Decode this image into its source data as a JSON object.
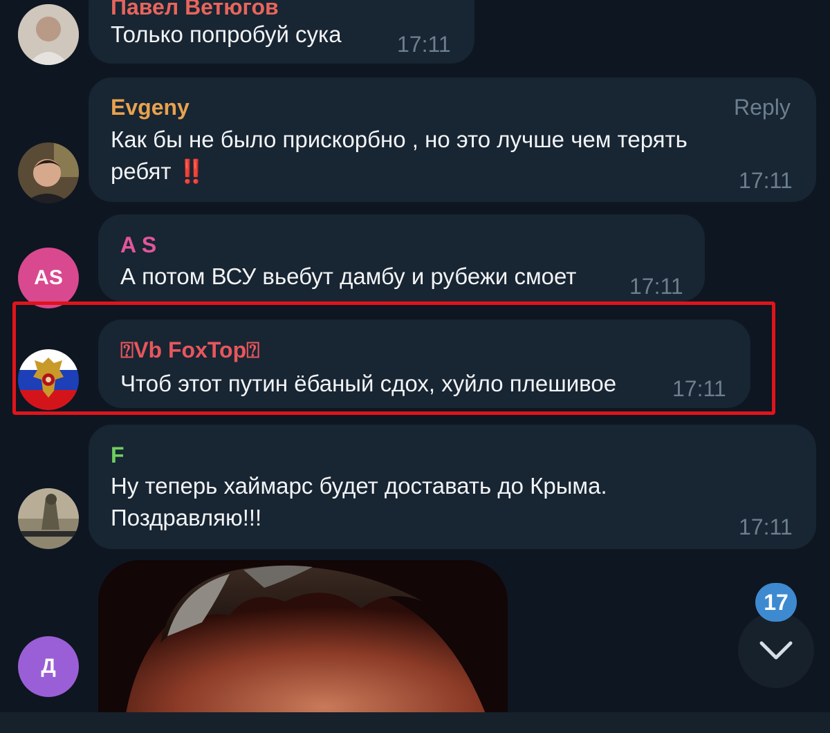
{
  "colors": {
    "background": "#0e1621",
    "bubble": "#182533",
    "time": "#6d7f8f",
    "highlight": "#e0141b",
    "badge": "#3e8ad0"
  },
  "messages": [
    {
      "sender": "Павел Ветюгов",
      "sender_color": "#e8655c",
      "text": "Только попробуй сука",
      "time": "17:11",
      "avatar": "photo"
    },
    {
      "sender": "Evgeny",
      "sender_color": "#e8a24e",
      "text": "Как бы не было прискорбно , но это лучше чем терять\nребят ‼️",
      "time": "17:11",
      "reply_label": "Reply",
      "avatar": "photo"
    },
    {
      "sender": "A S",
      "sender_color": "#e2569b",
      "text": "А потом ВСУ вьебут дамбу и рубежи смоет",
      "time": "17:11",
      "avatar_initials": "AS",
      "avatar_color": "#d9498f"
    },
    {
      "sender": "⍰Vb FoxTop⍰",
      "sender_color": "#e8565c",
      "text": "Чтоб этот путин ёбаный сдох, хуйло плешивое",
      "time": "17:11",
      "avatar": "russian-flag-coat-of-arms"
    },
    {
      "sender": "F",
      "sender_color": "#6fce5f",
      "text": "Ну теперь хаймарс будет доставать до Крыма.\nПоздравляю!!!",
      "time": "17:11",
      "avatar": "photo"
    },
    {
      "avatar_initials": "Д",
      "avatar_color": "#9a5fd6",
      "media": "photo"
    }
  ],
  "unread_count": "17",
  "icons": {
    "scroll_down": "chevron-down-icon"
  }
}
